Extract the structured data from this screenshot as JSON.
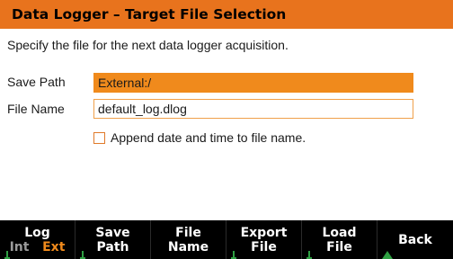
{
  "title": "Data Logger – Target File Selection",
  "description": "Specify the file for the next data logger acquisition.",
  "fields": {
    "save_path_label": "Save Path",
    "save_path_value": "External:/",
    "file_name_label": "File Name",
    "file_name_value": "default_log.dlog"
  },
  "append_option": {
    "label": "Append date and time to file name.",
    "checked": false
  },
  "softkeys": {
    "log_line1": "Log",
    "log_int": "Int",
    "log_ext": "Ext",
    "save_path_line1": "Save",
    "save_path_line2": "Path",
    "file_name_line1": "File",
    "file_name_line2": "Name",
    "export_line1": "Export",
    "export_line2": "File",
    "load_line1": "Load",
    "load_line2": "File",
    "back": "Back"
  },
  "colors": {
    "accent": "#e8731d",
    "active_field": "#f08a1c",
    "active_option": "#f08a1c",
    "inactive_option": "#9a9a9a",
    "softkey_bar": "#000000",
    "indicator": "#2fa043"
  },
  "icons": {
    "softkey_indicator": "tick-icon",
    "back_indicator": "up-arrow-icon"
  }
}
